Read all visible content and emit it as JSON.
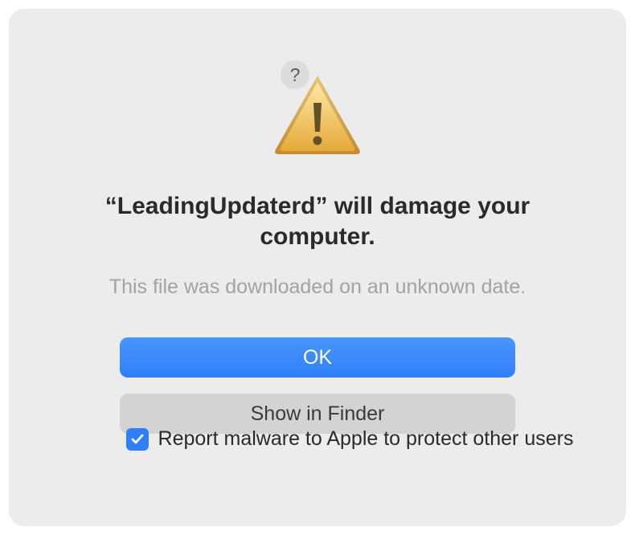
{
  "dialog": {
    "title_prefix": "“",
    "app_name": "LeadingUpdaterd",
    "title_suffix": "” will damage your computer.",
    "subtitle": "This file was downloaded on an unknown date.",
    "buttons": {
      "ok": "OK",
      "show_in_finder": "Show in Finder"
    },
    "checkbox": {
      "checked": true,
      "label": "Report malware to Apple to protect other users"
    },
    "help_label": "?"
  }
}
